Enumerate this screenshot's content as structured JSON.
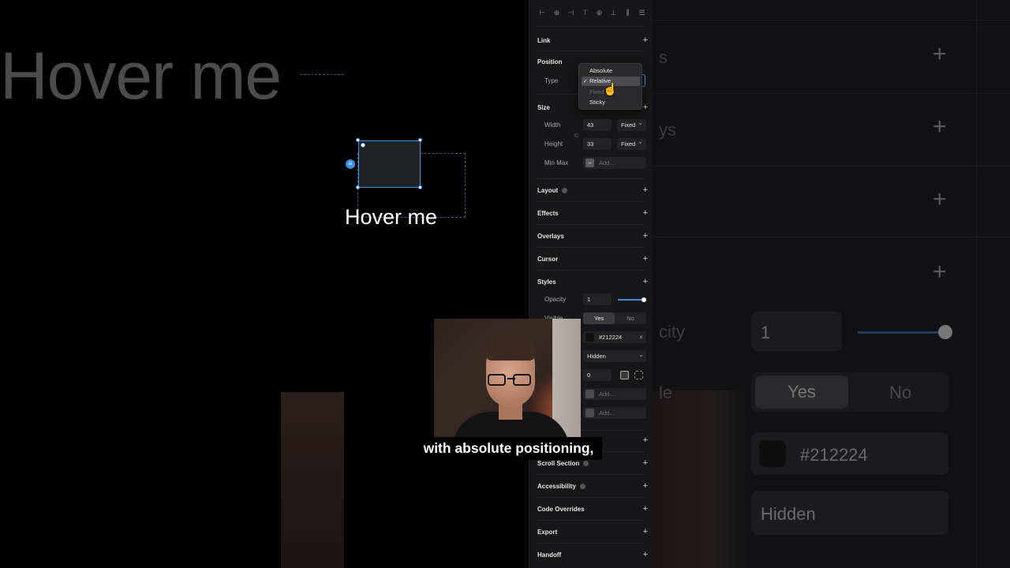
{
  "background": {
    "canvas_big_text": "Hover me",
    "right_fragments": [
      "s",
      "ys",
      "city",
      "le"
    ],
    "right_opacity_value": "1",
    "right_yes": "Yes",
    "right_no": "No",
    "right_fill_value": "#212224",
    "right_overflow_value": "Hidden"
  },
  "canvas": {
    "hover_text": "Hover me"
  },
  "panel": {
    "alignment_icons": [
      "align-left-icon",
      "align-center-h-icon",
      "align-right-icon",
      "align-top-icon",
      "align-center-v-icon",
      "align-bottom-icon",
      "distribute-h-icon",
      "distribute-v-icon"
    ],
    "link_label": "Link",
    "position": {
      "label": "Position",
      "type_label": "Type",
      "options": [
        "Absolute",
        "Relative",
        "Fixed",
        "Sticky"
      ],
      "selected": "Relative"
    },
    "size": {
      "label": "Size",
      "width_label": "Width",
      "width_value": "43",
      "width_mode": "Fixed",
      "height_label": "Height",
      "height_value": "33",
      "height_mode": "Fixed",
      "minmax_label": "Min Max",
      "minmax_placeholder": "Add..."
    },
    "layout_label": "Layout",
    "effects_label": "Effects",
    "overlays_label": "Overlays",
    "cursor_label": "Cursor",
    "styles": {
      "label": "Styles",
      "opacity_label": "Opacity",
      "opacity_value": "1",
      "visible_label": "Visible",
      "yes": "Yes",
      "no": "No",
      "fill_value": "#212224",
      "overflow_value": "Hidden",
      "radius_value": "0",
      "border_placeholder": "Add...",
      "shadow_placeholder": "Add..."
    },
    "scroll_section_label": "Scroll Section",
    "accessibility_label": "Accessibility",
    "code_overrides_label": "Code Overrides",
    "export_label": "Export",
    "handoff_label": "Handoff"
  },
  "caption": "with absolute positioning,"
}
